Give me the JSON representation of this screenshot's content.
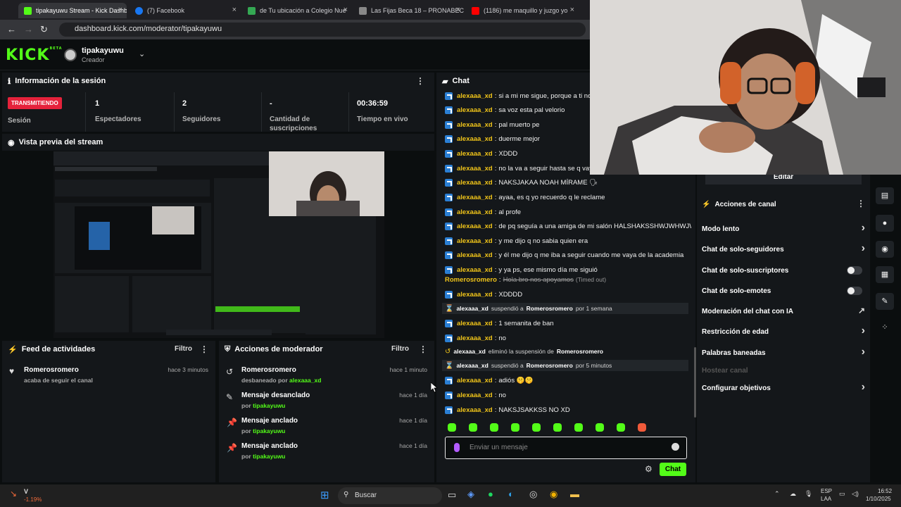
{
  "browser": {
    "tabs": [
      {
        "label": "tipakayuwu Stream - Kick Dashb",
        "active": true,
        "color": "#53fc18"
      },
      {
        "label": "(7) Facebook",
        "active": false,
        "color": "#1877f2"
      },
      {
        "label": "de Tu ubicación a Colegio Nue",
        "active": false,
        "color": "#34a853"
      },
      {
        "label": "Las Fijas Beca 18 – PRONABEC",
        "active": false,
        "color": "#888888"
      },
      {
        "label": "(1186) me maquillo y juzgo yo",
        "active": false,
        "color": "#ff0000"
      }
    ],
    "url": "dashboard.kick.com/moderator/tipakayuwu"
  },
  "header": {
    "logo": "KICK",
    "logo_tag": "BETA",
    "channel_name": "tipakayuwu",
    "channel_role": "Creador"
  },
  "session": {
    "title": "Información de la sesión",
    "status_badge": "TRANSMITIENDO",
    "status_label": "Sesión",
    "stats": [
      {
        "value": "1",
        "label": "Espectadores"
      },
      {
        "value": "2",
        "label": "Seguidores"
      },
      {
        "value": "-",
        "label": "Cantidad de suscripciones"
      },
      {
        "value": "00:36:59",
        "label": "Tiempo en vivo"
      }
    ]
  },
  "preview": {
    "title": "Vista previa del stream"
  },
  "activity": {
    "title": "Feed de actividades",
    "filter": "Filtro",
    "items": [
      {
        "user": "Romerosromero",
        "desc": "acaba de seguir el canal",
        "time": "hace 3 minutos"
      }
    ]
  },
  "modactions": {
    "title": "Acciones de moderador",
    "filter": "Filtro",
    "items": [
      {
        "title": "Romerosromero",
        "by_prefix": "desbaneado por",
        "by": "alexaaa_xd",
        "time": "hace 1 minuto"
      },
      {
        "title": "Mensaje desanclado",
        "by_prefix": "por",
        "by": "tipakayuwu",
        "time": "hace 1 día"
      },
      {
        "title": "Mensaje anclado",
        "by_prefix": "por",
        "by": "tipakayuwu",
        "time": "hace 1 día"
      },
      {
        "title": "Mensaje anclado",
        "by_prefix": "por",
        "by": "tipakayuwu",
        "time": "hace 1 día"
      }
    ]
  },
  "chat": {
    "title": "Chat",
    "messages": [
      {
        "user": "alexaaa_xd",
        "text": "si a mi me sigue, porque a ti no xd"
      },
      {
        "user": "alexaaa_xd",
        "text": "sa voz esta pal velorio"
      },
      {
        "user": "alexaaa_xd",
        "text": "pal muerto pe"
      },
      {
        "user": "alexaaa_xd",
        "text": "duerme mejor"
      },
      {
        "user": "alexaaa_xd",
        "text": "XDDD"
      },
      {
        "user": "alexaaa_xd",
        "text": "no la va a seguir hasta se q vaya a"
      },
      {
        "user": "alexaaa_xd",
        "text": "NAKSJAKAA NOAH MÍRAME 🗣"
      },
      {
        "user": "alexaaa_xd",
        "text": "ayaa, es q yo recuerdo q le reclame"
      },
      {
        "user": "alexaaa_xd",
        "text": "al profe"
      },
      {
        "user": "alexaaa_xd",
        "text": "de pq seguía a una amiga de mi salón HALSHAKSSHWJWHWJW"
      },
      {
        "user": "alexaaa_xd",
        "text": "y me dijo q no sabia quien era"
      },
      {
        "user": "alexaaa_xd",
        "text": "y él me dijo q me iba a seguir cuando me vaya de la academia"
      },
      {
        "user": "alexaaa_xd",
        "text": "y ya ps, ese mismo día me siguió"
      }
    ],
    "timed_out": {
      "user": "Romerosromero",
      "text": "Hola bro nos apoyamos",
      "note": "(Timed out)"
    },
    "sys1": {
      "actor": "alexaaa_xd",
      "verb": "suspendió a",
      "target": "Romerosromero",
      "tail": "por 1 semana"
    },
    "messages2": [
      {
        "user": "alexaaa_xd",
        "text": "XDDDD"
      },
      {
        "user": "alexaaa_xd",
        "text": "1 semanita de ban"
      },
      {
        "user": "alexaaa_xd",
        "text": "no"
      }
    ],
    "sys2": {
      "actor": "alexaaa_xd",
      "verb": "eliminó la suspensión de",
      "target": "Romerosromero",
      "tail": ""
    },
    "sys3": {
      "actor": "alexaaa_xd",
      "verb": "suspendió a",
      "target": "Romerosromero",
      "tail": "por 5 minutos"
    },
    "messages3": [
      {
        "user": "alexaaa_xd",
        "text": "adiós 🤫🤫"
      },
      {
        "user": "alexaaa_xd",
        "text": "no"
      },
      {
        "user": "alexaaa_xd",
        "text": "NAKSJSAKKSS NO XD"
      }
    ],
    "input_placeholder": "Enviar un mensaje",
    "send_label": "Chat"
  },
  "channel_actions": {
    "edit_label": "Editar",
    "title": "Acciones de canal",
    "items": [
      {
        "label": "Modo lento",
        "kind": "chevron"
      },
      {
        "label": "Chat de solo-seguidores",
        "kind": "chevron"
      },
      {
        "label": "Chat de solo-suscriptores",
        "kind": "toggle"
      },
      {
        "label": "Chat de solo-emotes",
        "kind": "toggle"
      },
      {
        "label": "Moderación del chat con IA",
        "kind": "external"
      },
      {
        "label": "Restricción de edad",
        "kind": "chevron"
      },
      {
        "label": "Palabras baneadas",
        "kind": "chevron"
      },
      {
        "label": "Hostear canal",
        "kind": "disabled"
      },
      {
        "label": "Configurar objetivos",
        "kind": "chevron"
      }
    ]
  },
  "taskbar": {
    "weather_label": "V",
    "weather_change": "-1.19%",
    "search_placeholder": "Buscar",
    "lang_top": "ESP",
    "lang_bottom": "LAA",
    "time": "16:52",
    "date": "1/10/2025"
  },
  "colors": {
    "accent": "#53fc18",
    "live": "#e5223b",
    "username": "#f0c419"
  }
}
